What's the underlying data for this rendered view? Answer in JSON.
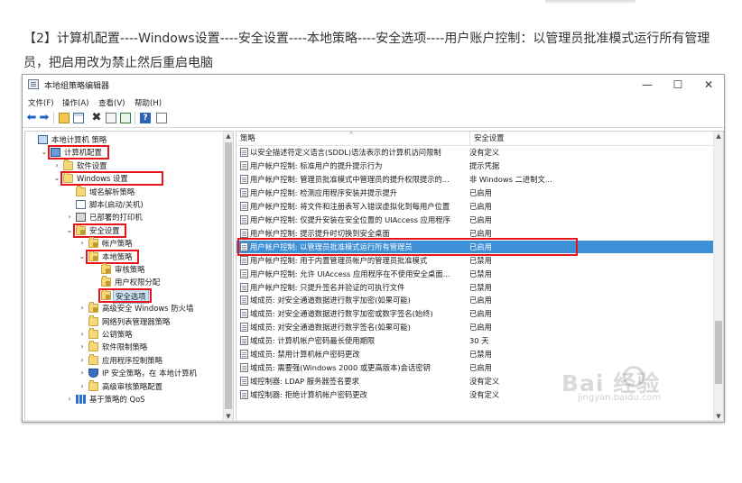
{
  "caption": "【2】计算机配置----Windows设置----安全设置----本地策略----安全选项----用户账户控制：以管理员批准模式运行所有管理员，把启用改为禁止然后重启电脑",
  "window": {
    "title": "本地组策略编辑器",
    "controls": {
      "minimize": "—",
      "maximize": "☐",
      "close": "✕"
    }
  },
  "menu": [
    "文件(F)",
    "操作(A)",
    "查看(V)",
    "帮助(H)"
  ],
  "toolbar_icons": [
    "back-icon",
    "forward-icon",
    "up-folder-icon",
    "show-hide-tree-icon",
    "delete-icon",
    "properties-icon",
    "export-icon",
    "help-icon",
    "view-icon"
  ],
  "tree": [
    {
      "label": "本地计算机 策略",
      "icon": "computer-icon",
      "level": 0,
      "chevron": ""
    },
    {
      "label": "计算机配置",
      "icon": "computer-config-icon",
      "level": 1,
      "chevron": "expanded",
      "highlight": true
    },
    {
      "label": "软件设置",
      "icon": "folder-icon",
      "level": 2,
      "chevron": "collapsed"
    },
    {
      "label": "Windows 设置",
      "icon": "folder-icon",
      "level": 2,
      "chevron": "expanded",
      "highlight": true
    },
    {
      "label": "域名解析策略",
      "icon": "folder-icon",
      "level": 3,
      "chevron": ""
    },
    {
      "label": "脚本(启动/关机)",
      "icon": "script-icon",
      "level": 3,
      "chevron": ""
    },
    {
      "label": "已部署的打印机",
      "icon": "printer-icon",
      "level": 3,
      "chevron": "collapsed"
    },
    {
      "label": "安全设置",
      "icon": "lock-folder-icon",
      "level": 3,
      "chevron": "expanded",
      "highlight": true
    },
    {
      "label": "帐户策略",
      "icon": "lock-folder-icon",
      "level": 4,
      "chevron": "collapsed"
    },
    {
      "label": "本地策略",
      "icon": "lock-folder-icon",
      "level": 4,
      "chevron": "expanded",
      "highlight": true
    },
    {
      "label": "审核策略",
      "icon": "lock-folder-icon",
      "level": 5,
      "chevron": ""
    },
    {
      "label": "用户权限分配",
      "icon": "lock-folder-icon",
      "level": 5,
      "chevron": ""
    },
    {
      "label": "安全选项",
      "icon": "lock-folder-icon",
      "level": 5,
      "chevron": "",
      "selected": true,
      "highlight": true
    },
    {
      "label": "高级安全 Windows 防火墙",
      "icon": "lock-folder-icon",
      "level": 4,
      "chevron": "collapsed"
    },
    {
      "label": "网络列表管理器策略",
      "icon": "folder-icon",
      "level": 4,
      "chevron": ""
    },
    {
      "label": "公钥策略",
      "icon": "folder-icon",
      "level": 4,
      "chevron": "collapsed"
    },
    {
      "label": "软件限制策略",
      "icon": "folder-icon",
      "level": 4,
      "chevron": "collapsed"
    },
    {
      "label": "应用程序控制策略",
      "icon": "folder-icon",
      "level": 4,
      "chevron": "collapsed"
    },
    {
      "label": "IP 安全策略，在 本地计算机",
      "icon": "shield-icon",
      "level": 4,
      "chevron": "collapsed"
    },
    {
      "label": "高级审核策略配置",
      "icon": "folder-icon",
      "level": 4,
      "chevron": "collapsed"
    },
    {
      "label": "基于策略的 QoS",
      "icon": "bar-chart-icon",
      "level": 3,
      "chevron": "collapsed"
    }
  ],
  "list": {
    "columns": [
      "策略",
      "安全设置"
    ],
    "rows": [
      {
        "policy": "以安全描述符定义语言(SDDL)语法表示的计算机访问限制",
        "setting": "没有定义"
      },
      {
        "policy": "用户帐户控制: 标准用户的提升提示行为",
        "setting": "提示凭据"
      },
      {
        "policy": "用户帐户控制: 管理员批准模式中管理员的提升权限提示的...",
        "setting": "非 Windows 二进制文..."
      },
      {
        "policy": "用户帐户控制: 检测应用程序安装并提示提升",
        "setting": "已启用"
      },
      {
        "policy": "用户帐户控制: 将文件和注册表写入错误虚拟化到每用户位置",
        "setting": "已启用"
      },
      {
        "policy": "用户帐户控制: 仅提升安装在安全位置的 UIAccess 应用程序",
        "setting": "已启用"
      },
      {
        "policy": "用户帐户控制: 提示提升时切换到安全桌面",
        "setting": "已启用"
      },
      {
        "policy": "用户帐户控制: 以管理员批准模式运行所有管理员",
        "setting": "已启用",
        "selected": true
      },
      {
        "policy": "用户帐户控制: 用于内置管理员帐户的管理员批准模式",
        "setting": "已禁用"
      },
      {
        "policy": "用户帐户控制: 允许 UIAccess 应用程序在不使用安全桌面...",
        "setting": "已禁用"
      },
      {
        "policy": "用户帐户控制: 只提升签名并验证的可执行文件",
        "setting": "已禁用"
      },
      {
        "policy": "域成员: 对安全通道数据进行数字加密(如果可能)",
        "setting": "已启用"
      },
      {
        "policy": "域成员: 对安全通道数据进行数字加密或数字签名(始终)",
        "setting": "已启用"
      },
      {
        "policy": "域成员: 对安全通道数据进行数字签名(如果可能)",
        "setting": "已启用"
      },
      {
        "policy": "域成员: 计算机帐户密码最长使用期限",
        "setting": "30 天"
      },
      {
        "policy": "域成员: 禁用计算机帐户密码更改",
        "setting": "已禁用"
      },
      {
        "policy": "域成员: 需要强(Windows 2000 或更高版本)会话密钥",
        "setting": "已启用"
      },
      {
        "policy": "域控制器: LDAP 服务器签名要求",
        "setting": "没有定义"
      },
      {
        "policy": "域控制器: 拒绝计算机帐户密码更改",
        "setting": "没有定义"
      }
    ]
  },
  "watermark": {
    "brand": "Bai 经验",
    "url": "jingyan.baidu.com"
  },
  "colors": {
    "highlight_box": "#e8141b",
    "selection": "#3d8fd6"
  }
}
